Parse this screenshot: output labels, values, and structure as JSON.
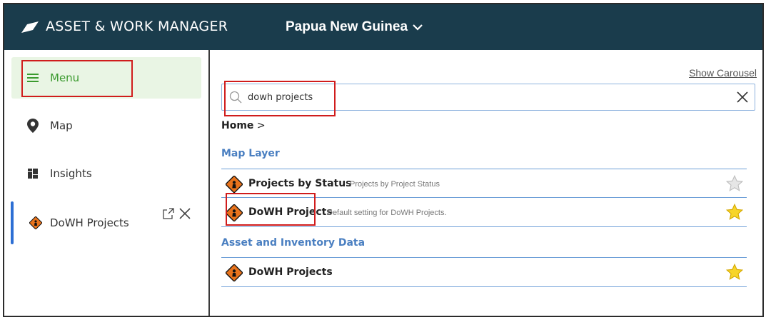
{
  "header": {
    "app_title": "ASSET & WORK MANAGER",
    "region": "Papua New Guinea",
    "background_color": "#1a3c4c"
  },
  "sidebar": {
    "items": [
      {
        "label": "Menu",
        "icon": "hamburger-icon",
        "active": true
      },
      {
        "label": "Map",
        "icon": "map-pin-icon"
      },
      {
        "label": "Insights",
        "icon": "dashboard-grid-icon"
      },
      {
        "label": "DoWH Projects",
        "icon": "roadwork-sign-icon",
        "open_tab": true
      }
    ],
    "accent_color": "#3a9a2e",
    "active_tab_color": "#2d6fd4"
  },
  "main": {
    "show_carousel": "Show Carousel",
    "search": {
      "value": "dowh projects",
      "placeholder": ""
    },
    "breadcrumb": {
      "home": "Home",
      "separator": ">"
    },
    "sections": [
      {
        "title": "Map Layer",
        "results": [
          {
            "title": "Projects by Status",
            "description": "Projects by Project Status",
            "favorite": false
          },
          {
            "title": "DoWH Projects",
            "description": "Default setting for DoWH Projects.",
            "favorite": true
          }
        ]
      },
      {
        "title": "Asset and Inventory Data",
        "results": [
          {
            "title": "DoWH Projects",
            "description": "",
            "favorite": true
          }
        ]
      }
    ],
    "section_color": "#4a7fc1",
    "highlight_color": "#d01c1c"
  }
}
